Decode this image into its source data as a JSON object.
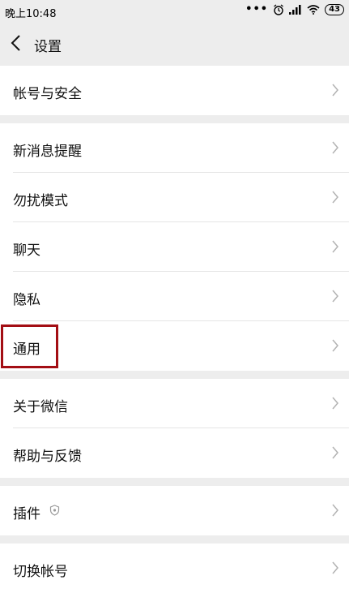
{
  "status_bar": {
    "time": "晚上10:48",
    "battery": "43"
  },
  "header": {
    "title": "设置"
  },
  "groups": [
    {
      "items": [
        {
          "label": "帐号与安全"
        }
      ]
    },
    {
      "items": [
        {
          "label": "新消息提醒"
        },
        {
          "label": "勿扰模式"
        },
        {
          "label": "聊天"
        },
        {
          "label": "隐私"
        },
        {
          "label": "通用"
        }
      ]
    },
    {
      "items": [
        {
          "label": "关于微信"
        },
        {
          "label": "帮助与反馈"
        }
      ]
    },
    {
      "items": [
        {
          "label": "插件"
        }
      ]
    },
    {
      "items": [
        {
          "label": "切换帐号"
        }
      ]
    }
  ],
  "highlighted_item": "通用",
  "accent_color": "#a30e14"
}
